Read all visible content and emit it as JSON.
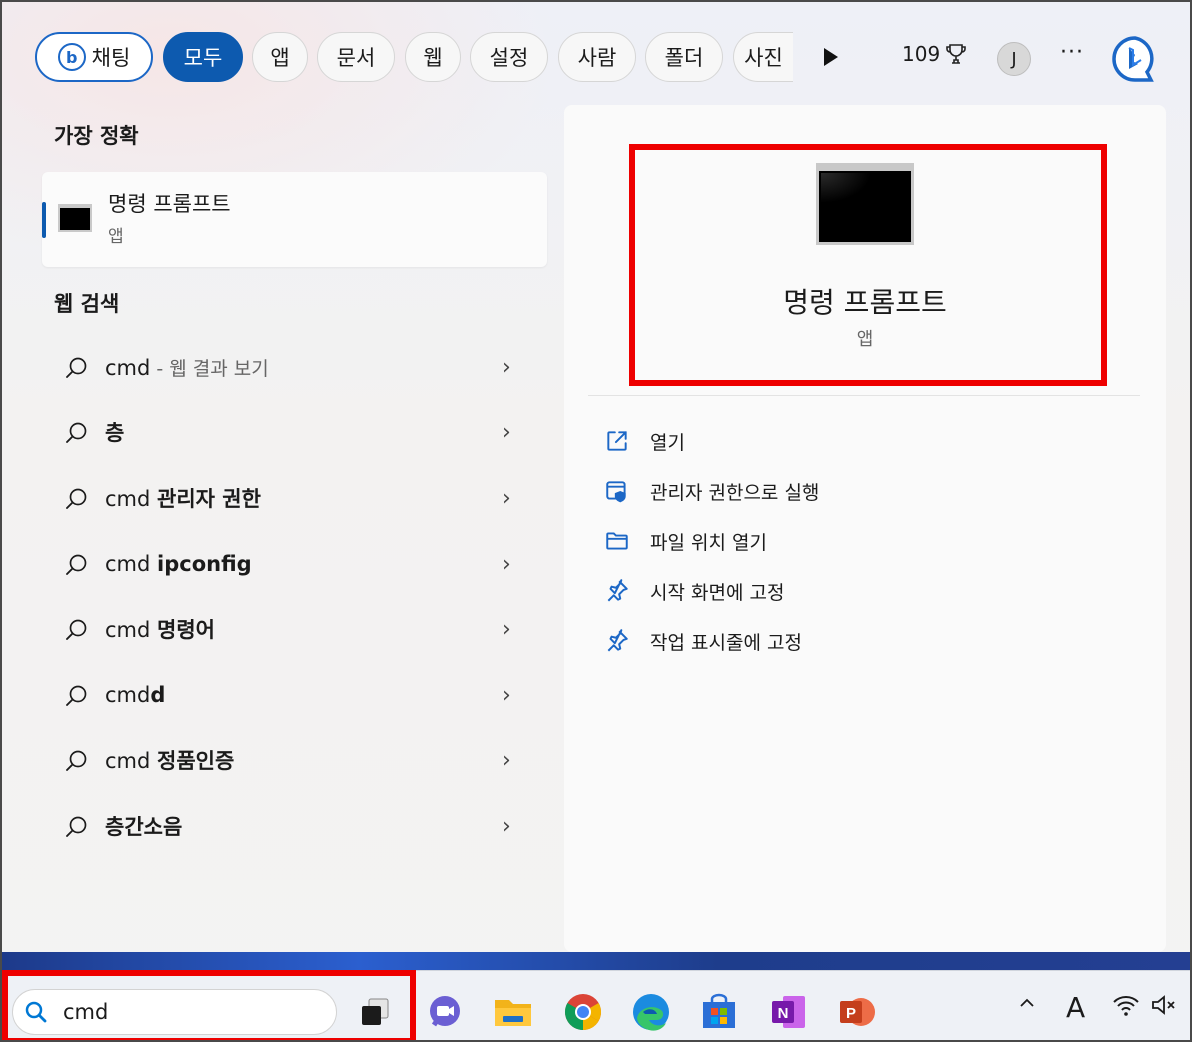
{
  "topbar": {
    "chips": [
      "채팅",
      "모두",
      "앱",
      "문서",
      "웹",
      "설정",
      "사람",
      "폴더",
      "사진"
    ],
    "active_chip": "모두",
    "points": "109",
    "avatar_initial": "J",
    "more_label": "···"
  },
  "best_match": {
    "section_title": "가장 정확",
    "name": "명령 프롬프트",
    "kind": "앱"
  },
  "web_search": {
    "section_title": "웹 검색",
    "items": [
      {
        "normal": "cmd",
        "bold": "",
        "hint": " - 웹 결과 보기"
      },
      {
        "normal": "",
        "bold": "층",
        "hint": ""
      },
      {
        "normal": "cmd ",
        "bold": "관리자 권한",
        "hint": ""
      },
      {
        "normal": "cmd ",
        "bold": "ipconfig",
        "hint": ""
      },
      {
        "normal": "cmd ",
        "bold": "명령어",
        "hint": ""
      },
      {
        "normal": "cmd",
        "bold": "d",
        "hint": ""
      },
      {
        "normal": "cmd ",
        "bold": "정품인증",
        "hint": ""
      },
      {
        "normal": "",
        "bold": "층간소음",
        "hint": ""
      }
    ],
    "chevron": "›"
  },
  "detail": {
    "app_name": "명령 프롬프트",
    "app_kind": "앱",
    "actions": [
      {
        "label": "열기",
        "icon": "open-external-icon"
      },
      {
        "label": "관리자 권한으로 실행",
        "icon": "shield-run-icon"
      },
      {
        "label": "파일 위치 열기",
        "icon": "folder-icon"
      },
      {
        "label": "시작 화면에 고정",
        "icon": "pin-icon"
      },
      {
        "label": "작업 표시줄에 고정",
        "icon": "pin-icon"
      }
    ]
  },
  "taskbar": {
    "search_value": "cmd",
    "apps": [
      "task-view-icon",
      "teams-chat-icon",
      "file-explorer-icon",
      "chrome-icon",
      "edge-icon",
      "store-icon",
      "onenote-icon",
      "powerpoint-icon"
    ],
    "tray": {
      "chevron": "^",
      "ime": "A"
    }
  },
  "colors": {
    "accent": "#0d5aaf",
    "highlight": "#ee0000",
    "icon_blue": "#1c67c6"
  }
}
